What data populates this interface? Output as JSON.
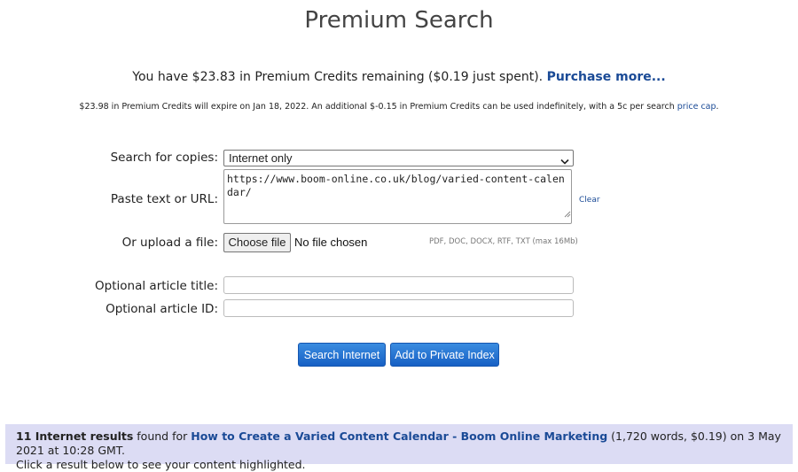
{
  "page": {
    "title": "Premium Search"
  },
  "credits": {
    "prefix": "You have $23.83 in Premium Credits remaining ($0.19 just spent).",
    "purchase_link": "Purchase more..."
  },
  "expiry": {
    "text": "$23.98 in Premium Credits will expire on Jan 18, 2022. An additional $-0.15 in Premium Credits can be used indefinitely, with a 5c per search",
    "price_cap_link": "price cap",
    "suffix": "."
  },
  "form": {
    "search_for_label": "Search for copies:",
    "search_for_value": "Internet only",
    "paste_label": "Paste text or URL:",
    "paste_value": "https://www.boom-online.co.uk/blog/varied-content-calendar/",
    "clear_link": "Clear",
    "upload_label": "Or upload a file:",
    "choose_file_button": "Choose file",
    "no_file_text": "No file chosen",
    "file_types_hint": "PDF, DOC, DOCX, RTF, TXT (max 16Mb)",
    "article_title_label": "Optional article title:",
    "article_title_value": "",
    "article_id_label": "Optional article ID:",
    "article_id_value": ""
  },
  "buttons": {
    "search_internet": "Search Internet",
    "add_private_index": "Add to Private Index"
  },
  "results": {
    "count_text": "11 Internet results",
    "found_for": " found for ",
    "article_link": "How to Create a Varied Content Calendar - Boom Online Marketing",
    "details": " (1,720 words, $0.19) on 3 May 2021 at 10:28 GMT.",
    "instruction": "Click a result below to see your content highlighted."
  },
  "colors": {
    "link": "#1a4a96",
    "button": "#1f6fd0",
    "result_bar": "#dcdcf4"
  }
}
